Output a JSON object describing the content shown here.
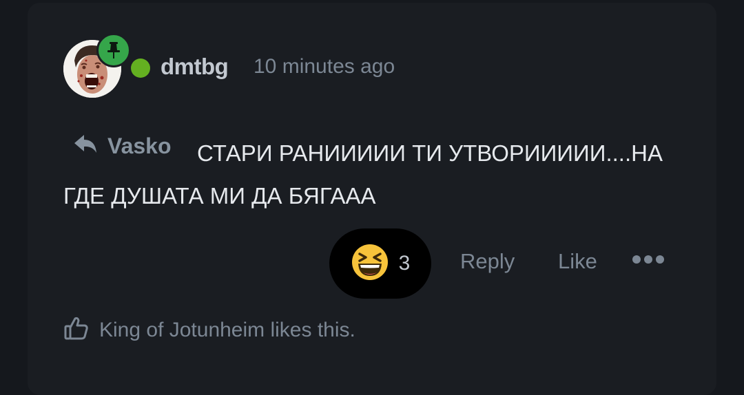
{
  "post": {
    "username": "dmtbg",
    "timestamp": "10 minutes ago",
    "reply_to": "Vasko",
    "body": "СТАРИ РАНИИИИИ ТИ УТВОРИИИИИ....НА ГДЕ ДУШАТА МИ ДА БЯГААА"
  },
  "reactions": {
    "emoji": "laughing-face",
    "count": "3"
  },
  "actions": {
    "reply_label": "Reply",
    "like_label": "Like"
  },
  "likes": {
    "text": "King of Jotunheim likes this."
  },
  "colors": {
    "background": "#15181d",
    "card": "#1a1d22",
    "pin_badge": "#35a64a",
    "online": "#64b021",
    "muted_text": "#7c8794",
    "body_text": "#e6e9ed"
  }
}
